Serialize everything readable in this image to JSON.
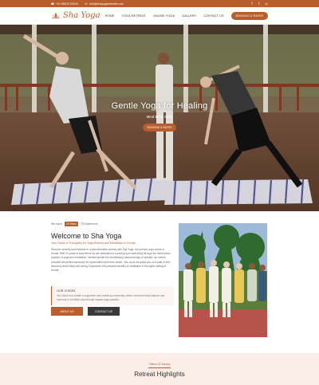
{
  "topbar": {
    "phone": "+91 98470 00010",
    "email": "info@shayogaretreats.com",
    "social_icons": [
      "facebook-icon",
      "twitter-icon",
      "instagram-icon"
    ]
  },
  "header": {
    "logo_text": "Sha Yoga",
    "nav": [
      "HOME",
      "YOGA RETREAT",
      "ONLINE YOGA",
      "GALLERY",
      "CONTACT US"
    ],
    "book_button": "BOOKING & RATES"
  },
  "hero": {
    "title": "Gentle Yoga for Healing",
    "subtitle": "Mind Body Spirit",
    "button": "BOOKING & RATES"
  },
  "about": {
    "meta_prefix": "We Have",
    "meta_years": "20 Years",
    "meta_suffix": "Of Experience",
    "title": "Welcome to Sha Yoga",
    "tagline": "Your Oasis of Tranquility for Yoga Retreat and Meditation in Kerala",
    "paragraph": "Discover serenity and wellness in a transformative journey with Sha Yoga, the premier yoga centre in Kerala. With 20 years of experience we are dedicated to nurturing your well-being through the harmonious practice of yoga and meditation. Nestled amidst the breathtaking natural beauty of Varkala, our retreat provides the perfect sanctuary for rejuvenation and inner peace. Join us as we guide you on a path of self-discovery and holistic well-being. Experience the personal benefits of meditation in the idyllic setting of Kerala.",
    "vision_title": "OUR VISION",
    "vision_text": "Our vision is to create a supportive and nurturing community, where members finds balance and harmony in a holistic way through regular yoga practice.",
    "about_button": "ABOUT US",
    "contact_button": "CONTACT US"
  },
  "highlights": {
    "label": "Offers Of Variety",
    "title": "Retreat Highlights"
  },
  "colors": {
    "accent": "#b85e2c",
    "dark_button": "#3a3a3a",
    "highlights_bg": "#fbeee9"
  }
}
